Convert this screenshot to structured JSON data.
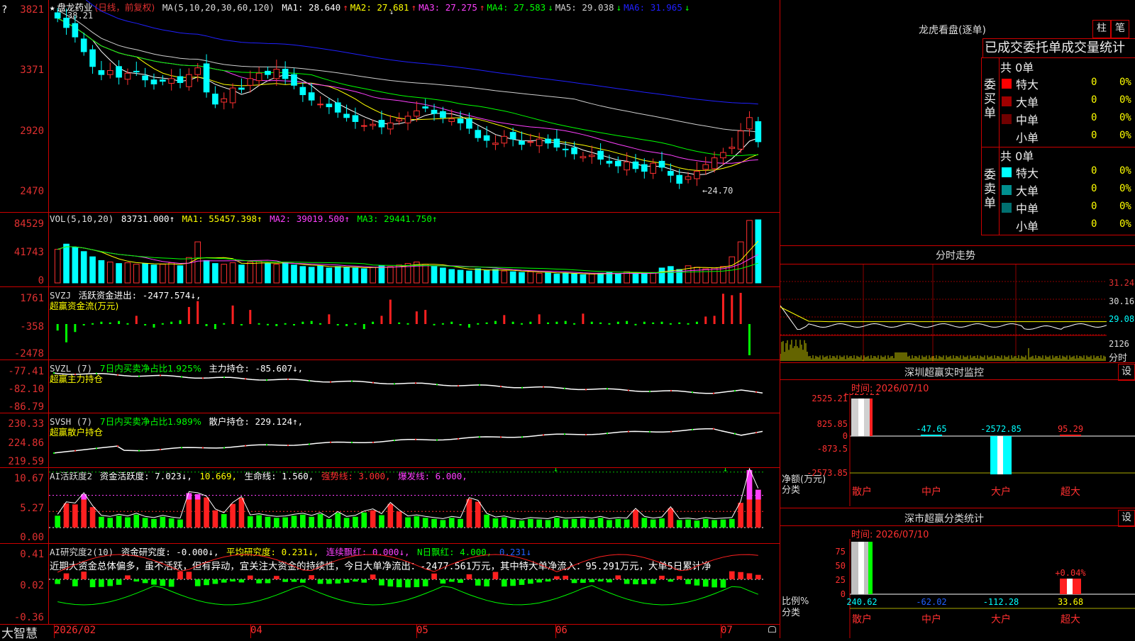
{
  "main": {
    "stock_title": "盘龙药业",
    "period": "(日线，前复权)",
    "ma_header": "MA(5,10,20,30,60,120)",
    "ma": [
      {
        "label": "MA1: 28.640",
        "arrow": "↑",
        "color": "#ffffff"
      },
      {
        "label": "MA2: 27.681",
        "arrow": "↑",
        "color": "#ffff00"
      },
      {
        "label": "MA3: 27.275",
        "arrow": "↑",
        "color": "#ff40ff"
      },
      {
        "label": "MA4: 27.583",
        "arrow": "↓",
        "color": "#00ff00"
      },
      {
        "label": "MA5: 29.038",
        "arrow": "↓",
        "color": "#d0d0d0"
      },
      {
        "label": "MA6: 31.965",
        "arrow": "↓",
        "color": "#2020ff"
      }
    ],
    "y_ticks": [
      "3821",
      "3371",
      "2920",
      "2470"
    ],
    "high_label": "38.21",
    "low_label": "←24.70",
    "arrow_mark": "↓"
  },
  "vol": {
    "header": "VOL(5,10,20)",
    "value": "83731.000↑",
    "ma1": "MA1: 55457.398↑",
    "ma2": "MA2: 39019.500↑",
    "ma3": "MA3: 29441.750↑",
    "y_ticks": [
      "84529",
      "41743",
      "0"
    ]
  },
  "svzj": {
    "header": "SVZJ",
    "item": "活跃资金进出: -2477.574↓,",
    "sub": "超赢资金流(万元)",
    "y_ticks": [
      "1761",
      "-358",
      "-2478"
    ]
  },
  "svzl": {
    "header": "SVZL (7)",
    "ratio": "7日内买卖净占比1.925%",
    "item": "主力持仓: -85.607↓,",
    "sub": "超赢主力持仓",
    "y_ticks": [
      "-77.41",
      "-82.10",
      "-86.79"
    ]
  },
  "svsh": {
    "header": "SVSH (7)",
    "ratio": "7日内买卖净占比1.989%",
    "item": "散户持仓: 229.124↑,",
    "sub": "超赢散户持仓",
    "y_ticks": [
      "230.33",
      "224.86",
      "219.59"
    ]
  },
  "ai1": {
    "header": "AI活跃度2",
    "item1": "资金活跃度: 7.023↓,",
    "item2": "10.669,",
    "item3": "生命线: 1.560,",
    "item4": "强势线: 3.000,",
    "item5": "爆发线: 6.000,",
    "y_ticks": [
      "10.67",
      "5.27",
      "0.00"
    ]
  },
  "ai2": {
    "header": "AI研究度2(10)",
    "item1": "资金研究度: -0.000↓,",
    "item2": "平均研究度: 0.231↓,",
    "item3": "连续飘红: 0.000↓,",
    "item4": "N日飘红: 4.000,",
    "item5": "0.231↓",
    "commentary": "近期大资金总体偏多，虽不活跃，但有异动，宜关注大资金的持续性，今日大单净流出：-2477.561万元，其中特大单净流入：95.291万元，大单5日累计净",
    "y_ticks": [
      "0.41",
      "0.02",
      "-0.36"
    ]
  },
  "xaxis": {
    "brand": "大智慧",
    "labels": [
      "2026/02",
      "04",
      "05",
      "06",
      "07"
    ]
  },
  "lhb": {
    "title": "龙虎看盘(逐单)",
    "btn1": "柱",
    "btn2": "笔",
    "subtitle": "已成交委托单成交量统计",
    "buy_label": "委买单",
    "sell_label": "委卖单",
    "buy_total": "共 0单",
    "sell_total": "共 0单",
    "buy_rows": [
      {
        "name": "特大",
        "count": "0",
        "pct": "0%",
        "color": "#ff0000"
      },
      {
        "name": "大单",
        "count": "0",
        "pct": "0%",
        "color": "#a00000"
      },
      {
        "name": "中单",
        "count": "0",
        "pct": "0%",
        "color": "#700000"
      },
      {
        "name": "小单",
        "count": "0",
        "pct": "0%",
        "color": "#000000"
      }
    ],
    "sell_rows": [
      {
        "name": "特大",
        "count": "0",
        "pct": "0%",
        "color": "#00ffff"
      },
      {
        "name": "大单",
        "count": "0",
        "pct": "0%",
        "color": "#009090"
      },
      {
        "name": "中单",
        "count": "0",
        "pct": "0%",
        "color": "#007070"
      },
      {
        "name": "小单",
        "count": "0",
        "pct": "0%",
        "color": "#000000"
      }
    ]
  },
  "fenshi": {
    "title": "分时走势",
    "y_ticks": [
      "31.24",
      "30.16",
      "29.08",
      "2126"
    ],
    "unit": "分时"
  },
  "sz_monitor": {
    "title": "深圳超赢实时监控",
    "btn": "设",
    "time": "时间: 2026/07/10",
    "y_ticks": [
      "2525.21",
      "825.85",
      "0",
      "-873.5",
      "-2573.85"
    ],
    "unit1": "净额(万元)",
    "unit2": "分类",
    "bars": [
      {
        "cat": "散户",
        "value": "2525.21"
      },
      {
        "cat": "中户",
        "value": "-47.65"
      },
      {
        "cat": "大户",
        "value": "-2572.85"
      },
      {
        "cat": "超大",
        "value": "95.29"
      }
    ]
  },
  "sz_class": {
    "title": "深市超赢分类统计",
    "btn": "设",
    "time": "时间: 2026/07/10",
    "y_ticks": [
      "75",
      "50",
      "25",
      "0"
    ],
    "unit1": "比例%",
    "unit2": "分类",
    "pct_label": "+0.04%",
    "bars": [
      {
        "cat": "散户",
        "value": "240.62"
      },
      {
        "cat": "中户",
        "value": "-62.02"
      },
      {
        "cat": "大户",
        "value": "-112.28"
      },
      {
        "cat": "超大",
        "value": "33.68"
      }
    ]
  },
  "chart_data": {
    "type": "candlestick",
    "x_range": [
      "2026/02",
      "2026/07/10"
    ],
    "ylim": [
      24.7,
      38.21
    ],
    "close": [
      37.6,
      36.9,
      36.2,
      35.1,
      34.0,
      33.4,
      33.7,
      33.2,
      33.5,
      33.6,
      33.0,
      32.7,
      32.9,
      33.1,
      32.8,
      33.4,
      33.9,
      32.1,
      31.2,
      31.6,
      32.4,
      32.3,
      33.1,
      33.5,
      33.4,
      33.8,
      33.1,
      32.6,
      31.9,
      31.5,
      31.2,
      31.0,
      30.6,
      30.2,
      29.9,
      29.6,
      29.7,
      29.5,
      29.8,
      30.1,
      30.3,
      30.7,
      30.9,
      30.5,
      30.2,
      30.1,
      29.8,
      29.4,
      28.7,
      28.5,
      28.3,
      28.8,
      28.6,
      28.2,
      28.4,
      28.6,
      28.3,
      28.0,
      27.8,
      27.5,
      27.3,
      27.4,
      27.1,
      26.8,
      26.6,
      26.9,
      26.4,
      26.2,
      26.8,
      26.5,
      25.9,
      25.3,
      25.8,
      26.2,
      26.7,
      27.2,
      27.6,
      28.0,
      29.2,
      30.2,
      28.4
    ],
    "volume": [
      45000,
      52000,
      48000,
      42000,
      35000,
      30000,
      28000,
      26000,
      27000,
      25000,
      26000,
      24000,
      25000,
      27000,
      23000,
      34000,
      55000,
      30000,
      26000,
      25000,
      27000,
      24000,
      28000,
      29000,
      26000,
      25000,
      27000,
      24000,
      22000,
      21000,
      23000,
      20000,
      22000,
      21000,
      20000,
      19000,
      21000,
      23000,
      22000,
      24000,
      26000,
      28000,
      25000,
      22000,
      20000,
      18000,
      17000,
      16000,
      19000,
      17000,
      18000,
      16000,
      15000,
      14000,
      15000,
      13000,
      14000,
      12000,
      13000,
      12000,
      11000,
      12000,
      13000,
      14000,
      12000,
      15000,
      13000,
      12000,
      14000,
      20000,
      22000,
      18000,
      23000,
      21000,
      19000,
      20000,
      22000,
      35000,
      55000,
      83731,
      84529
    ],
    "svzj": [
      -800,
      -1600,
      -900,
      -400,
      -300,
      -200,
      -250,
      -150,
      -300,
      200,
      -400,
      -600,
      -300,
      -200,
      -100,
      800,
      1200,
      -500,
      -700,
      -300,
      900,
      -400,
      600,
      -300,
      -350,
      -500,
      -300,
      -400,
      -200,
      -150,
      -300,
      300,
      -400,
      -500,
      -300,
      -700,
      -200,
      200,
      1300,
      -250,
      -300,
      500,
      600,
      -350,
      -300,
      -200,
      -400,
      -600,
      -300,
      -250,
      -150,
      250,
      -200,
      -300,
      -200,
      300,
      -250,
      -200,
      -150,
      -300,
      350,
      -200,
      -250,
      -300,
      -200,
      -150,
      -350,
      -200,
      -250,
      -200,
      -300,
      -250,
      -300,
      -200,
      150,
      200,
      1700,
      1600,
      1761,
      -2478
    ],
    "ai_activity": [
      2.2,
      4.5,
      4.3,
      6.2,
      3.8,
      2.0,
      1.8,
      2.2,
      1.9,
      2.4,
      1.8,
      1.6,
      2.0,
      1.7,
      1.5,
      6.4,
      6.2,
      5.6,
      3.2,
      2.5,
      4.4,
      5.5,
      2.1,
      2.3,
      2.0,
      1.8,
      1.9,
      2.2,
      2.4,
      2.0,
      2.5,
      1.6,
      2.7,
      1.8,
      2.0,
      2.8,
      3.2,
      2.3,
      4.4,
      3.0,
      1.9,
      2.1,
      1.8,
      1.6,
      1.4,
      1.8,
      1.6,
      5.3,
      4.8,
      2.4,
      1.7,
      1.9,
      1.5,
      1.3,
      1.6,
      1.5,
      1.4,
      1.8,
      1.5,
      1.6,
      1.7,
      1.5,
      1.8,
      1.4,
      1.6,
      1.5,
      3.3,
      1.8,
      1.5,
      1.7,
      3.6,
      1.4,
      1.5,
      1.3,
      1.6,
      1.4,
      1.5,
      1.6,
      4.6,
      10.67,
      7.02
    ]
  },
  "colors": {
    "up": "#ff3030",
    "down": "#00ffff",
    "border": "#c00000",
    "axis_text": "#e03030",
    "ma_white": "#ffffff",
    "ma_yellow": "#ffff00",
    "ma_magenta": "#ff40ff",
    "ma_green": "#00ff00",
    "ma_gray": "#d0d0d0",
    "ma_blue": "#2020ff"
  }
}
